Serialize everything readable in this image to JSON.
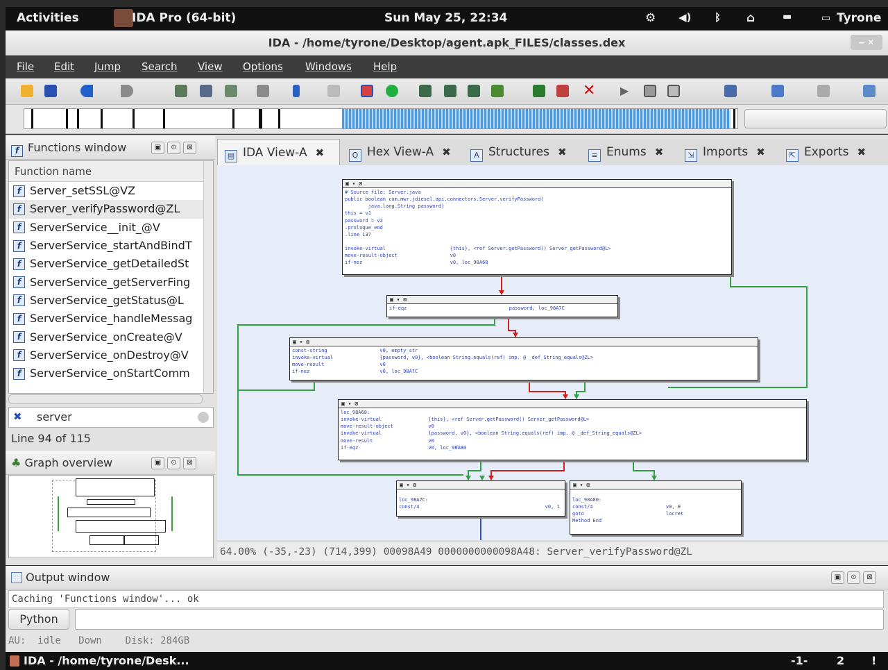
{
  "topbar": {
    "activities": "Activities",
    "app": "IDA Pro (64-bit)",
    "clock": "Sun May 25, 22:34",
    "user": "Tyrone"
  },
  "window": {
    "title": "IDA - /home/tyrone/Desktop/agent.apk_FILES/classes.dex"
  },
  "menu": [
    "File",
    "Edit",
    "Jump",
    "Search",
    "View",
    "Options",
    "Windows",
    "Help"
  ],
  "functions_window": {
    "title": "Functions window",
    "column": "Function name",
    "items": [
      "Server_setSSL@VZ",
      "Server_verifyPassword@ZL",
      "ServerService__init_@V",
      "ServerService_startAndBindT",
      "ServerService_getDetailedSt",
      "ServerService_getServerFing",
      "ServerService_getStatus@L",
      "ServerService_handleMessag",
      "ServerService_onCreate@V",
      "ServerService_onDestroy@V",
      "ServerService_onStartComm"
    ],
    "selected_index": 1,
    "search_value": "server",
    "line_info": "Line 94 of 115"
  },
  "graph_overview": {
    "title": "Graph overview"
  },
  "tabs": [
    {
      "label": "IDA View-A",
      "icon": "ida-view-icon",
      "active": true
    },
    {
      "label": "Hex View-A",
      "icon": "hex-view-icon",
      "active": false
    },
    {
      "label": "Structures",
      "icon": "structures-icon",
      "active": false
    },
    {
      "label": "Enums",
      "icon": "enums-icon",
      "active": false
    },
    {
      "label": "Imports",
      "icon": "imports-icon",
      "active": false
    },
    {
      "label": "Exports",
      "icon": "exports-icon",
      "active": false
    }
  ],
  "graph": {
    "nodes": [
      {
        "id": "n1",
        "lines": "# Source file: Server.java\npublic boolean com.mwr.jdiesel.api.connectors.Server.verifyPassword(\n        java.lang.String password)\nthis = v1\npassword = v2\n.prologue_end\n.line 137\n\ninvoke-virtual                      {this}, <ref Server.getPassword() Server_getPassword@L>\nmove-result-object                  v0\nif-nez                              v0, loc_98A68"
      },
      {
        "id": "n2",
        "lines": "if-eqz                                   password, loc_98A7C"
      },
      {
        "id": "n3",
        "lines": "const-string                  v0, empty_str\ninvoke-virtual                {password, v0}, <boolean String.equals(ref) imp. @ _def_String_equals@ZL>\nmove-result                   v0\nif-nez                        v0, loc_98A7C"
      },
      {
        "id": "n4",
        "lines": "loc_98A68:\ninvoke-virtual                {this}, <ref Server.getPassword() Server_getPassword@L>\nmove-result-object            v0\ninvoke-virtual                {password, v0}, <boolean String.equals(ref) imp. @ _def_String_equals@ZL>\nmove-result                   v0\nif-eqz                        v0, loc_98A80"
      },
      {
        "id": "n5",
        "lines": "loc_98A7C:\nconst/4                                           v0, 1"
      },
      {
        "id": "n6",
        "lines": "loc_98A80:\nconst/4                         v0, 0\ngoto                            locret\nMethod End"
      }
    ]
  },
  "graph_status": "64.00% (-35,-23) (714,399) 00098A49 0000000000098A48: Server_verifyPassword@ZL",
  "output": {
    "title": "Output window",
    "log": "Caching 'Functions window'... ok",
    "python_button": "Python",
    "status": "AU:  idle   Down    Disk: 284GB"
  },
  "taskbar": {
    "task": "IDA - /home/tyrone/Desk...",
    "workspace": "-1-",
    "num": "2",
    "excl": "!"
  }
}
